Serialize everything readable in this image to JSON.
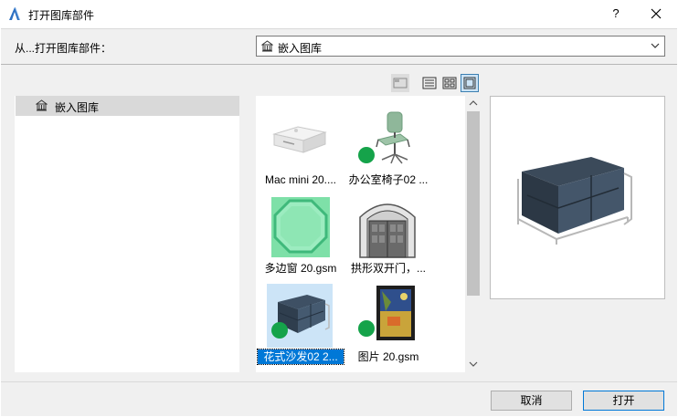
{
  "window": {
    "title": "打开图库部件",
    "help_symbol": "?",
    "close_symbol": "✕"
  },
  "source": {
    "label": "从...打开图库部件：",
    "selected": "嵌入图库"
  },
  "view_modes": [
    "folder-view",
    "list-view",
    "grid-view",
    "large-icon-view"
  ],
  "tree": {
    "items": [
      {
        "label": "嵌入图库",
        "icon": "library-icon",
        "selected": true
      }
    ]
  },
  "items": [
    {
      "label": "Mac mini 20....",
      "icon": "mac-mini-thumbnail",
      "badge": false,
      "selected": false
    },
    {
      "label": "办公室椅子02 ...",
      "icon": "office-chair-thumbnail",
      "badge": true,
      "selected": false
    },
    {
      "label": "多边窗 20.gsm",
      "icon": "polygon-window-thumbnail",
      "badge": false,
      "selected": false
    },
    {
      "label": "拱形双开门，...",
      "icon": "arched-double-door-thumbnail",
      "badge": false,
      "selected": false
    },
    {
      "label": "花式沙发02 2...",
      "icon": "sofa-thumbnail",
      "badge": true,
      "selected": true
    },
    {
      "label": "图片 20.gsm",
      "icon": "picture-thumbnail",
      "badge": true,
      "selected": false
    }
  ],
  "buttons": {
    "cancel": "取消",
    "open": "打开"
  },
  "colors": {
    "selection": "#0078d7",
    "badge": "#15a34a",
    "active_view": "#cce4f7"
  }
}
